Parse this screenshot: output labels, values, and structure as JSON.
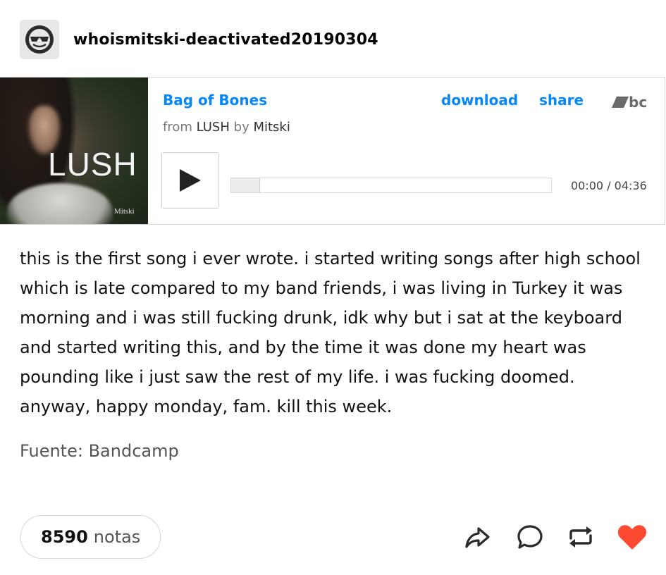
{
  "header": {
    "username": "whoismitski-deactivated20190304"
  },
  "player": {
    "album_art_title": "LUSH",
    "album_art_artist": "Mitski",
    "track_title": "Bag of Bones",
    "from_prefix": "from",
    "album": "LUSH",
    "by_prefix": "by",
    "artist": "Mitski",
    "download_label": "download",
    "share_label": "share",
    "bc_logo_text": "bc",
    "progress": 0,
    "time_display": "00:00 / 04:36",
    "link_color": "#0687f5"
  },
  "post": {
    "caption": "this is the first song i ever wrote. i started writing songs after high school which is late compared to my band friends, i was living in Turkey it was morning and i was still fucking drunk, idk why but i sat at the keyboard and started writing this, and by the time it was done my heart was pounding like i just saw the rest of my life. i was fucking doomed. anyway, happy monday, fam. kill this week.",
    "source": "Fuente: Bandcamp"
  },
  "footer": {
    "notes_count": "8590",
    "notes_label": "notas",
    "icons": [
      "share-icon",
      "reply-icon",
      "reblog-icon",
      "like-icon"
    ],
    "like_color": "#ff4930"
  }
}
